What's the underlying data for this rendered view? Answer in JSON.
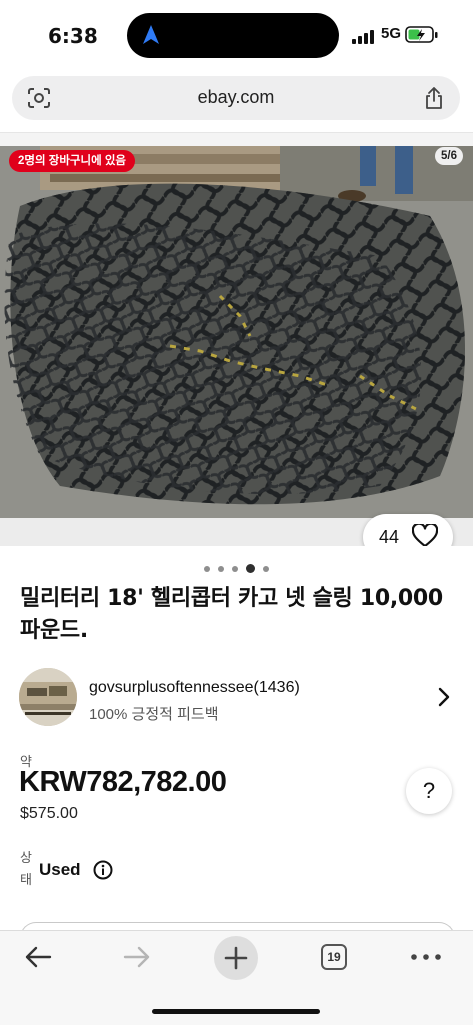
{
  "status_bar": {
    "time": "6:38",
    "network": "5G",
    "icons": [
      "location-arrow-icon",
      "signal-icon",
      "battery-charging-icon"
    ]
  },
  "browser": {
    "url": "ebay.com",
    "icons": [
      "lens-icon",
      "share-icon"
    ]
  },
  "gallery": {
    "cart_badge": "2명의 장바구니에 있음",
    "image_counter": "5/6",
    "watch_count": "44",
    "dots_total": 5,
    "dots_active_index": 3
  },
  "listing": {
    "title": "밀리터리 18' 헬리콥터 카고 넷 슬링 10,000 파운드."
  },
  "seller": {
    "name": "govsurplusoftennessee(1436)",
    "feedback": "100% 긍정적 피드백"
  },
  "price": {
    "approx_label": "약",
    "amount": "KRW782,782.00",
    "usd": "$575.00",
    "help_label": "?"
  },
  "condition": {
    "label": "상태",
    "value": "Used"
  },
  "toolbar": {
    "tabs_count": "19",
    "icons": [
      "back-arrow-icon",
      "forward-arrow-icon",
      "plus-icon",
      "tabs-icon",
      "more-icon"
    ]
  },
  "colors": {
    "badge_red": "#e0001b",
    "net_black": "#1f2224",
    "ground_gray": "#8a8a86"
  }
}
